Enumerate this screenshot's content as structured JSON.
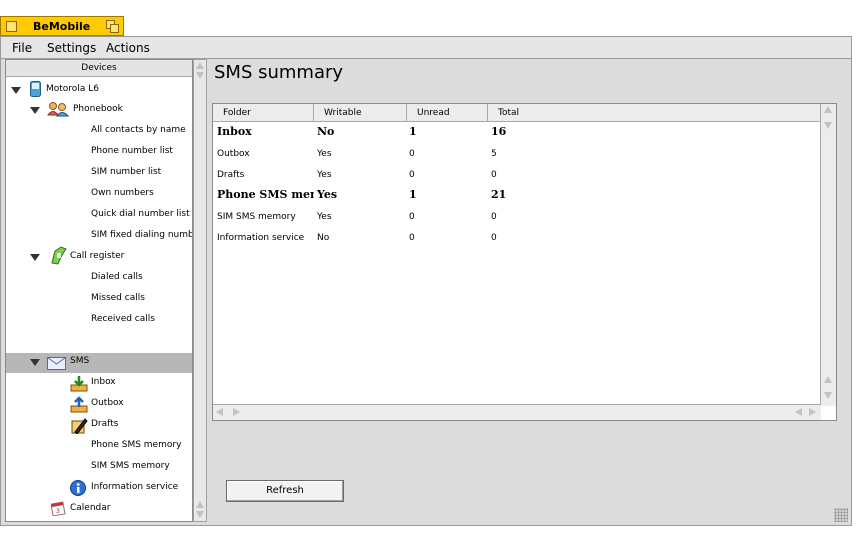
{
  "window": {
    "title": "BeMobile"
  },
  "menu": {
    "file": "File",
    "settings": "Settings",
    "actions": "Actions"
  },
  "sidebar": {
    "header": "Devices",
    "device": "Motorola L6",
    "phonebook": {
      "label": "Phonebook",
      "items": [
        "All contacts by name",
        "Phone number list",
        "SIM number list",
        "Own numbers",
        "Quick dial number list",
        "SIM fixed dialing numbers"
      ]
    },
    "call_register": {
      "label": "Call register",
      "items": [
        "Dialed calls",
        "Missed calls",
        "Received calls"
      ]
    },
    "sms": {
      "label": "SMS",
      "inbox": "Inbox",
      "outbox": "Outbox",
      "drafts": "Drafts",
      "phone_mem": "Phone SMS memory",
      "sim_mem": "SIM SMS memory",
      "info": "Information service"
    },
    "calendar": "Calendar"
  },
  "main": {
    "title": "SMS summary",
    "columns": [
      "Folder",
      "Writable",
      "Unread",
      "Total"
    ],
    "rows": [
      [
        "Inbox",
        "No",
        "1",
        "16"
      ],
      [
        "Outbox",
        "Yes",
        "0",
        "5"
      ],
      [
        "Drafts",
        "Yes",
        "0",
        "0"
      ],
      [
        "Phone SMS mem",
        "Yes",
        "1",
        "21"
      ],
      [
        "SIM SMS memory",
        "Yes",
        "0",
        "0"
      ],
      [
        "Information service",
        "No",
        "0",
        "0"
      ]
    ],
    "refresh_label": "Refresh"
  },
  "icons": {
    "device": "phone-icon",
    "phonebook": "contacts-icon",
    "call_register": "call-icon",
    "sms": "envelope-icon",
    "inbox": "inbox-icon",
    "outbox": "outbox-icon",
    "drafts": "drafts-icon",
    "info": "info-icon",
    "calendar": "calendar-icon"
  }
}
